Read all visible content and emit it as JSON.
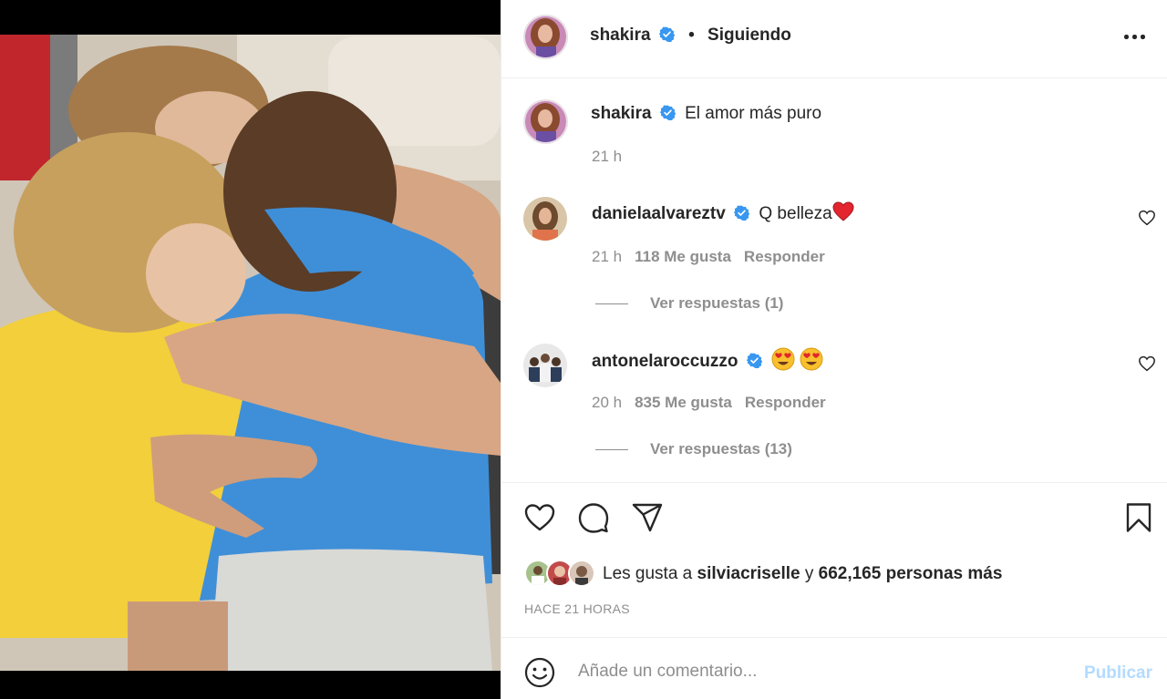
{
  "post": {
    "author": "shakira",
    "follow_separator": "•",
    "follow_status": "Siguiendo",
    "caption": {
      "username": "shakira",
      "text": "El amor más puro",
      "time": "21 h"
    }
  },
  "comments": [
    {
      "username": "danielaalvareztv",
      "text": "Q belleza",
      "emoji": "red-heart",
      "time": "21 h",
      "likes": "118 Me gusta",
      "reply_label": "Responder",
      "view_replies": "Ver respuestas (1)"
    },
    {
      "username": "antonelaroccuzzo",
      "text": "",
      "emoji": "heart-eyes x2",
      "time": "20 h",
      "likes": "835 Me gusta",
      "reply_label": "Responder",
      "view_replies": "Ver respuestas (13)"
    }
  ],
  "likes_summary": {
    "prefix": "Les gusta a ",
    "user": "silviacriselle",
    "conjunction": " y ",
    "others": "662,165 personas más"
  },
  "timestamp": "HACE 21 HORAS",
  "comment_box": {
    "placeholder": "Añade un comentario...",
    "submit_label": "Publicar"
  },
  "colors": {
    "verified": "#3897f0",
    "publish_disabled": "#b3dbff",
    "secondary_text": "#8e8e8e",
    "heart_red": "#ed4956"
  }
}
